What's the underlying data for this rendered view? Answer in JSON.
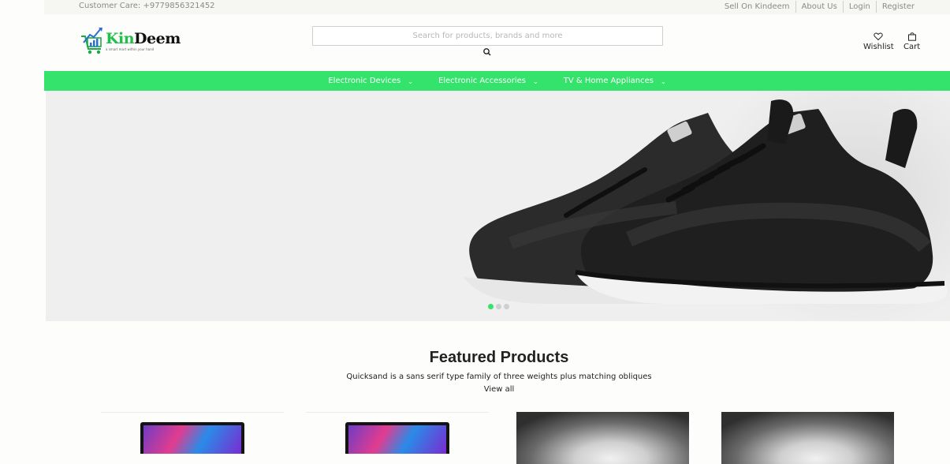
{
  "topbar": {
    "customer_care": "Customer Care: +9779856321452",
    "links": [
      "Sell On Kindeem",
      "About Us",
      "Login",
      "Register"
    ]
  },
  "header": {
    "logo_brand_a": "Kin",
    "logo_brand_b": "Deem",
    "logo_tagline": "a smart mart within your hand",
    "search_placeholder": "Search for products, brands and more",
    "wishlist_label": "Wishlist",
    "cart_label": "Cart"
  },
  "nav": {
    "items": [
      {
        "label": "Electronic Devices"
      },
      {
        "label": "Electronic Accessories"
      },
      {
        "label": "TV & Home Appliances"
      }
    ]
  },
  "hero": {
    "slides_count": 3,
    "active_slide": 1
  },
  "featured": {
    "title": "Featured Products",
    "subtitle": "Quicksand is a sans serif type family of three weights plus matching obliques",
    "view_all": "View all"
  },
  "colors": {
    "accent_green": "#34e36b",
    "topbar_bg": "#f6f6f3",
    "hero_bg": "#efefef"
  },
  "icons": [
    "logo-cart-icon",
    "search-icon",
    "heart-icon",
    "bag-icon",
    "chevron-down-icon"
  ]
}
